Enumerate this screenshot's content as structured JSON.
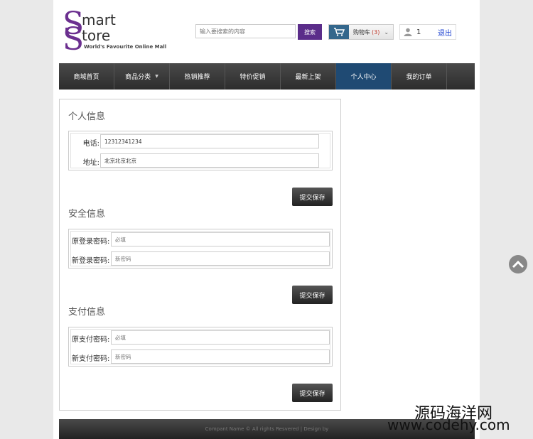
{
  "logo": {
    "line1_initial": "S",
    "line1_rest": "mart",
    "line2_initial": "S",
    "line2_rest": "tore",
    "tagline": "World's Favourite Online Mall"
  },
  "search": {
    "placeholder": "输入要搜索的内容",
    "button_label": "搜索"
  },
  "cart": {
    "label": "购物车",
    "count": "(3)",
    "caret": "⌄"
  },
  "user": {
    "name": "1",
    "logout_label": "退出"
  },
  "nav": {
    "items": [
      {
        "label": "商城首页"
      },
      {
        "label": "商品分类",
        "caret": "▼"
      },
      {
        "label": "热销推荐"
      },
      {
        "label": "特价促销"
      },
      {
        "label": "最新上架"
      },
      {
        "label": "个人中心",
        "active": true
      },
      {
        "label": "我的订单"
      }
    ]
  },
  "personal": {
    "title": "个人信息",
    "phone_label": "电话:",
    "phone_value": "12312341234",
    "address_label": "地址:",
    "address_value": "北京北京北京",
    "save_label": "提交保存"
  },
  "security": {
    "title": "安全信息",
    "old_label": "原登录密码:",
    "old_placeholder": "必填",
    "new_label": "新登录密码:",
    "new_placeholder": "新密码",
    "save_label": "提交保存"
  },
  "payment": {
    "title": "支付信息",
    "old_label": "原支付密码:",
    "old_placeholder": "必填",
    "new_label": "新支付密码:",
    "new_placeholder": "新密码",
    "save_label": "提交保存"
  },
  "footer": {
    "text": "Compant Name © All rights Resvered | Design by"
  },
  "watermark": {
    "line1": "源码海洋网",
    "line2": "www.codehy.com"
  },
  "colors": {
    "brand": "#6b2f8f",
    "nav_active": "#1f4a73",
    "search_button": "#5b2d8a"
  }
}
